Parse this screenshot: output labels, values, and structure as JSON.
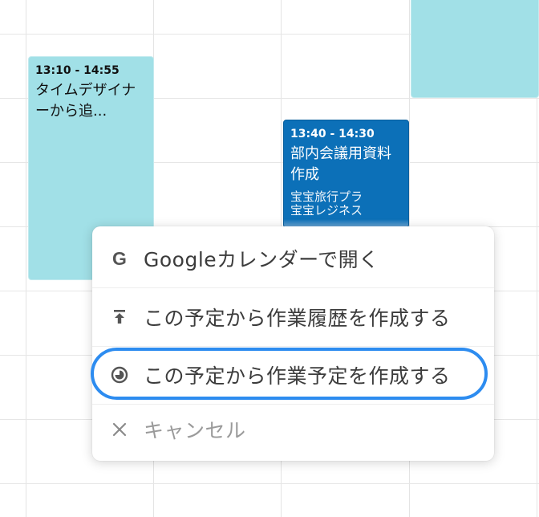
{
  "events": [
    {
      "time": "13:10 - 14:55",
      "title": "タイムデザイナーから追..."
    },
    {
      "time": "13:40 - 14:30",
      "title": "部内会議用資料作成",
      "extra1": "宝宝旅行プラ",
      "extra2": "宝宝レジネス"
    }
  ],
  "menu": {
    "items": [
      {
        "label": "Googleカレンダーで開く",
        "icon": "google-g-icon"
      },
      {
        "label": "この予定から作業履歴を作成する",
        "icon": "upload-arrow-icon"
      },
      {
        "label": "この予定から作業予定を作成する",
        "icon": "clock-icon"
      },
      {
        "label": "キャンセル",
        "icon": "close-icon"
      }
    ],
    "highlight_color": "#2d8cf0"
  },
  "colors": {
    "event_light": "#a1e0e7",
    "event_dark": "#0c70b8"
  }
}
